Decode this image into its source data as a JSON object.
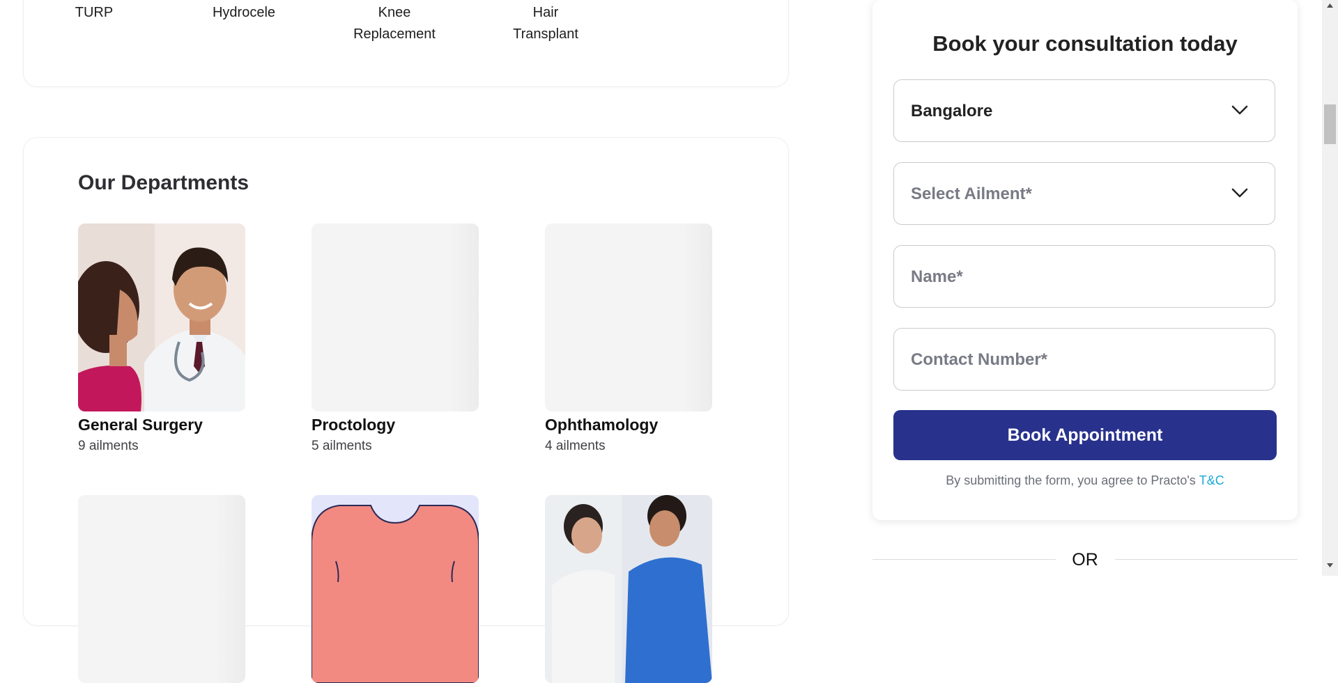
{
  "ailments": [
    "TURP",
    "Hydrocele",
    "Knee\nReplacement",
    "Hair\nTransplant"
  ],
  "departments": {
    "title": "Our Departments",
    "items": [
      {
        "name": "General Surgery",
        "count": "9 ailments"
      },
      {
        "name": "Proctology",
        "count": "5 ailments"
      },
      {
        "name": "Ophthamology",
        "count": "4 ailments"
      }
    ]
  },
  "booking": {
    "title": "Book your consultation today",
    "city_value": "Bangalore",
    "ailment_placeholder": "Select Ailment*",
    "name_placeholder": "Name*",
    "contact_placeholder": "Contact Number*",
    "button_label": "Book Appointment",
    "terms_text": "By submitting the form, you agree to Practo's",
    "terms_link": "T&C",
    "or_label": "OR"
  },
  "colors": {
    "primary_button": "#28328c",
    "link": "#1aa9d8"
  },
  "icons": [
    "chevron-down-icon"
  ]
}
